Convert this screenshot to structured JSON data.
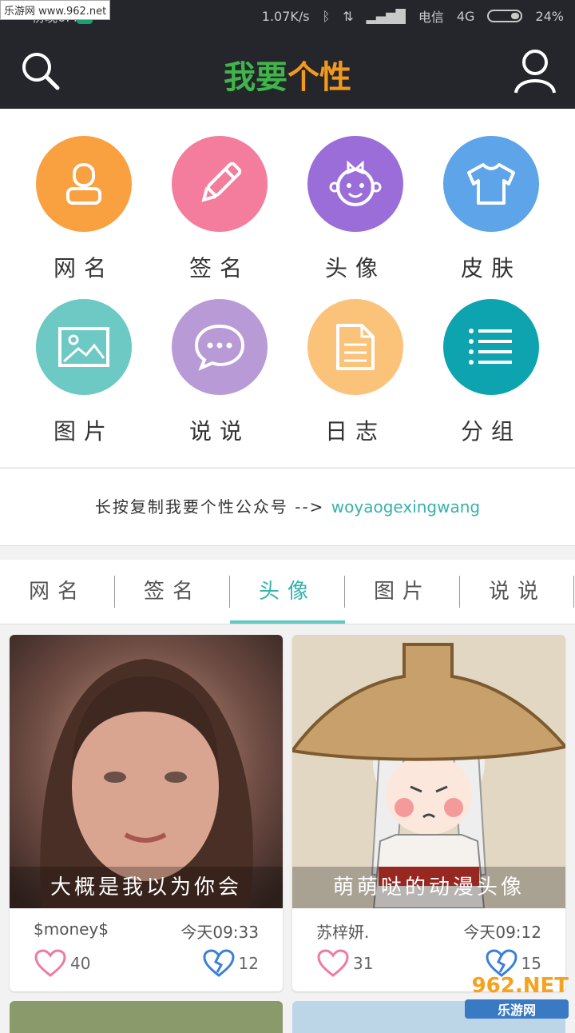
{
  "status_bar": {
    "watermark": "乐游网 www.962.net",
    "time": "傍晚6:47",
    "network_speed": "1.07K/s",
    "carrier": "电信",
    "network_type": "4G",
    "battery": "24%"
  },
  "header": {
    "title_part1": "我要",
    "title_part2": "个性",
    "icons": [
      "search-icon",
      "user-icon"
    ]
  },
  "categories": [
    {
      "label": "网名",
      "color": "#f9a041",
      "icon": "person-icon"
    },
    {
      "label": "签名",
      "color": "#f47c9d",
      "icon": "pen-icon"
    },
    {
      "label": "头像",
      "color": "#9a6dd9",
      "icon": "face-icon"
    },
    {
      "label": "皮肤",
      "color": "#5ea4e8",
      "icon": "shirt-icon"
    },
    {
      "label": "图片",
      "color": "#6cc9c4",
      "icon": "picture-icon"
    },
    {
      "label": "说说",
      "color": "#b89ad6",
      "icon": "chat-icon"
    },
    {
      "label": "日志",
      "color": "#fbc27a",
      "icon": "document-icon"
    },
    {
      "label": "分组",
      "color": "#0da4b0",
      "icon": "list-icon"
    }
  ],
  "notice": {
    "text": "长按复制我要个性公众号 -->",
    "handle": "woyaogexingwang"
  },
  "tabs": [
    {
      "label": "网名"
    },
    {
      "label": "签名"
    },
    {
      "label": "头像",
      "active": true
    },
    {
      "label": "图片"
    },
    {
      "label": "说说"
    }
  ],
  "cards": [
    {
      "caption": "大概是我以为你会",
      "author": "$money$",
      "time": "今天09:33",
      "likes": "40",
      "breaks": "12"
    },
    {
      "caption": "萌萌哒的动漫头像",
      "author": "苏梓妍.",
      "time": "今天09:12",
      "likes": "31",
      "breaks": "15"
    }
  ],
  "watermark_bottom": {
    "brand": "962.NET",
    "sub": "乐游网"
  },
  "colors": {
    "header_bg": "#24262b",
    "accent": "#36b2ad",
    "title_green": "#3fb54a",
    "title_orange": "#f39a1e",
    "heart_pink": "#f07aa0",
    "broken_heart_blue": "#3b7fd8"
  }
}
